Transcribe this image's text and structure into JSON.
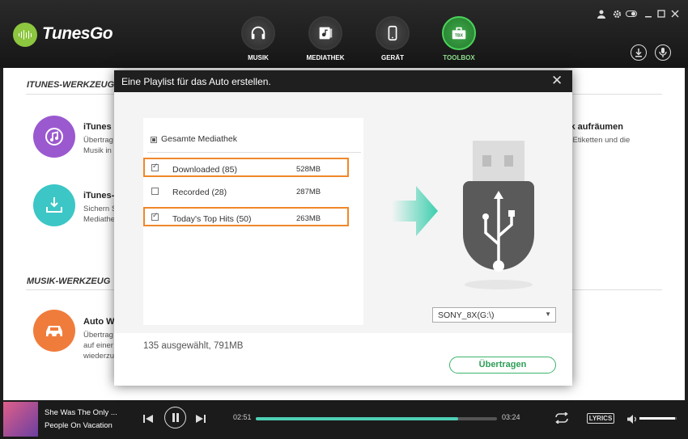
{
  "app": {
    "title": "TunesGo",
    "nav": [
      {
        "label": "MUSIK",
        "icon": "headphones-icon"
      },
      {
        "label": "MEDIATHEK",
        "icon": "media-library-icon"
      },
      {
        "label": "GERÄT",
        "icon": "phone-icon"
      },
      {
        "label": "TOOLBOX",
        "icon": "toolbox-icon",
        "badge": "TBX",
        "active": true
      }
    ]
  },
  "main": {
    "section_itunes": "ITUNES-WERKZEUG",
    "section_musik": "MUSIK-WERKZEUG",
    "tools": [
      {
        "title": "iTunes M",
        "desc": [
          "Übertrag",
          "Musik in"
        ],
        "color": "#9b59d0",
        "icon": "music-transfer-icon"
      },
      {
        "title": "iTunes-B",
        "desc": [
          "Sichern S",
          "Mediathe"
        ],
        "color": "#3cc6c6",
        "icon": "backup-icon"
      },
      {
        "title": "Auto W",
        "desc": [
          "Übertrag",
          "auf einer",
          "wiederzu"
        ],
        "color": "#f07c3c",
        "icon": "car-icon"
      }
    ],
    "right_tool": {
      "title": "thek aufräumen",
      "desc": "usik Etiketten und die"
    }
  },
  "dialog": {
    "title": "Eine Playlist für das Auto erstellen.",
    "library_label": "Gesamte Mediathek",
    "playlists": [
      {
        "name": "Downloaded (85)",
        "size": "528MB",
        "checked": true,
        "highlighted": true
      },
      {
        "name": "Recorded (28)",
        "size": "287MB",
        "checked": false,
        "highlighted": false
      },
      {
        "name": "Today's Top Hits (50)",
        "size": "263MB",
        "checked": true,
        "highlighted": true
      }
    ],
    "device": "SONY_8X(G:\\)",
    "selection_summary": "135 ausgewählt, 791MB",
    "transfer_label": "Übertragen"
  },
  "player": {
    "title": "She Was The Only ...",
    "artist": "People On Vacation",
    "elapsed": "02:51",
    "duration": "03:24",
    "progress": 0.84,
    "lyrics_label": "LYRICS",
    "volume": 0.95
  },
  "colors": {
    "accent_green": "#3cb46b",
    "highlight_orange": "#f0882a",
    "progress": "#4fd0b6"
  }
}
